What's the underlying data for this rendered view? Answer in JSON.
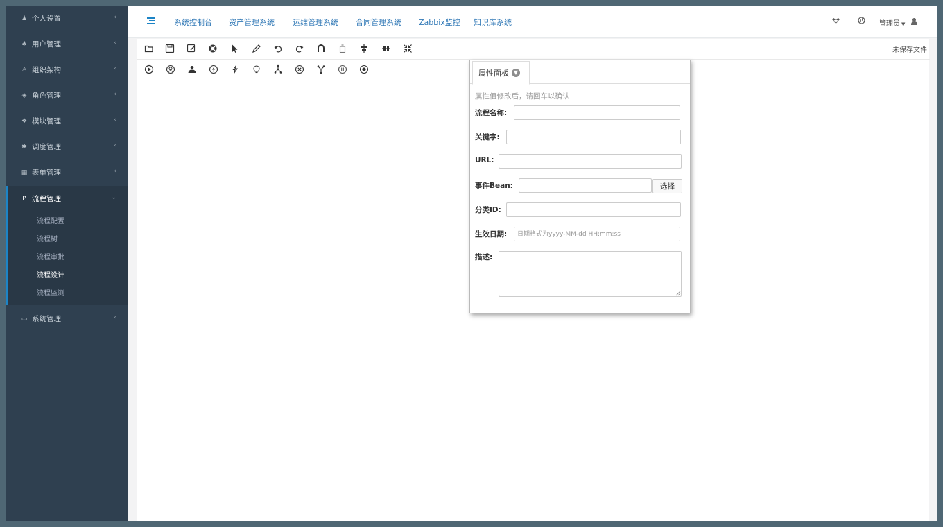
{
  "sidebar": {
    "items": [
      {
        "label": "个人设置",
        "icon": "user-icon",
        "glyph": "♟"
      },
      {
        "label": "用户管理",
        "icon": "users-icon",
        "glyph": "♣"
      },
      {
        "label": "组织架构",
        "icon": "sitemap-icon",
        "glyph": "♙"
      },
      {
        "label": "角色管理",
        "icon": "eye-slash-icon",
        "glyph": "◈"
      },
      {
        "label": "模块管理",
        "icon": "cubes-icon",
        "glyph": "❖"
      },
      {
        "label": "调度管理",
        "icon": "asterisk-icon",
        "glyph": "✱"
      }
    ],
    "items_after": [
      {
        "label": "表单管理",
        "icon": "th-large-icon",
        "glyph": "▦"
      }
    ],
    "active_group": {
      "label": "流程管理",
      "icon": "paypal-icon",
      "glyph": "P",
      "sub_items": [
        "流程配置",
        "流程树",
        "流程审批",
        "流程设计",
        "流程监测"
      ],
      "current": "流程设计"
    },
    "last_item": {
      "label": "系统管理",
      "icon": "laptop-icon",
      "glyph": "▭"
    }
  },
  "topbar": {
    "tabs": [
      "系统控制台",
      "资产管理系统",
      "运维管理系统",
      "合同管理系统",
      "Zabbix监控",
      "知识库系统"
    ],
    "user_label": "管理员",
    "icons": [
      "dropbox-icon",
      "globe-icon",
      "user-icon"
    ]
  },
  "toolbar": {
    "row1_icons": [
      "folder-open-icon",
      "save-icon",
      "save-as-icon",
      "life-ring-icon",
      "pointer-icon",
      "pencil-icon",
      "undo-icon",
      "redo-icon",
      "magnet-icon",
      "trash-icon",
      "align-center-icon",
      "align-middle-icon",
      "compress-icon"
    ],
    "row2_icons": [
      "play-circle-icon",
      "user-circle-icon",
      "user-group-icon",
      "bolt-circle-icon",
      "flash-icon",
      "lightbulb-icon",
      "fork-icon",
      "close-circle-icon",
      "join-icon",
      "pause-circle-icon",
      "stop-circle-icon"
    ],
    "unsaved_label": "未保存文件"
  },
  "panel": {
    "tab_label": "属性面板",
    "hint": "属性值修改后，请回车以确认",
    "fields": {
      "flow_name": {
        "label": "流程名称:",
        "value": ""
      },
      "keyword": {
        "label": "关键字:",
        "value": ""
      },
      "url": {
        "label": "URL:",
        "value": ""
      },
      "event_bean": {
        "label": "事件Bean:",
        "value": "",
        "button": "选择"
      },
      "category_id": {
        "label": "分类ID:",
        "value": ""
      },
      "effective_date": {
        "label": "生效日期:",
        "value": "",
        "placeholder": "日期格式为yyyy-MM-dd HH:mm:ss"
      },
      "description": {
        "label": "描述:",
        "value": ""
      }
    }
  },
  "colors": {
    "sidebar_bg": "#2f4050",
    "sidebar_active": "#293846",
    "accent": "#1c84c6",
    "link": "#337ab7"
  }
}
